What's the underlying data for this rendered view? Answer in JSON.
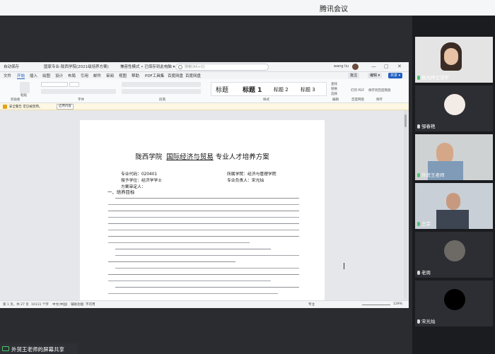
{
  "app": {
    "title": "腾讯会议"
  },
  "word": {
    "titlebar": {
      "autosave": "自动保存",
      "doc_name": "国家专业-陇西学院(2021级培养方案)",
      "compat": "兼容性模式 • 已保存到此电脑 ▾",
      "search_placeholder": "搜索(Alt+Q)",
      "user": "wang liu",
      "minimize": "—",
      "restore": "▢",
      "close": "✕"
    },
    "menus": [
      "文件",
      "开始",
      "插入",
      "绘图",
      "设计",
      "布局",
      "引用",
      "邮件",
      "审阅",
      "视图",
      "帮助",
      "PDF工具集",
      "百度网盘",
      "百度网盘"
    ],
    "active_menu": "开始",
    "menu_buttons": {
      "comment": "批注",
      "edit": "编辑 ▾",
      "share": "共享 ▾"
    },
    "ribbon": {
      "groups": [
        "剪贴板",
        "字体",
        "段落",
        "样式",
        "编辑",
        "百度网盘",
        "保存"
      ],
      "paste": "粘贴",
      "styles": [
        "标题",
        "标题 1",
        "标题 2",
        "标题 3"
      ],
      "find": "查找",
      "replace": "替换",
      "select": "选择",
      "open_pdf": "打印 PDF",
      "save_to_baidu": "保存到百度网盘"
    },
    "notice": {
      "label": "安全警告",
      "text": "宏已被禁用。",
      "button": "启用内容"
    },
    "document": {
      "title_prefix": "陇西学院",
      "title_major": "国际经济与贸易",
      "title_suffix": "专业人才培养方案",
      "code_label": "专业代码：020401",
      "college_label": "所属学院：经济与管理学院",
      "degree_label": "授予学位：经济学学士",
      "leader_label": "专业负责人：宋光灿",
      "reviewer_label": "方案审定人：",
      "section_1": "一、培养目标"
    },
    "status": {
      "page": "第 1 页，共 27 页",
      "words": "10111 个字",
      "lang": "中文(中国)",
      "accessibility": "辅助功能: 不可用",
      "focus": "专注",
      "zoom": "129%"
    }
  },
  "participants": [
    {
      "name": "杨光烨王浩宇",
      "type": "video",
      "mic": "on"
    },
    {
      "name": "邹春艳",
      "type": "avatar",
      "mic": "off"
    },
    {
      "name": "外贸王老师",
      "type": "video",
      "mic": "on"
    },
    {
      "name": "王宗",
      "type": "video",
      "mic": "on"
    },
    {
      "name": "老周",
      "type": "avatar",
      "mic": "off"
    },
    {
      "name": "宋光灿",
      "type": "avatar",
      "mic": "off"
    }
  ],
  "share_label": "外贸王老师的屏幕共享",
  "colors": {
    "word_blue": "#1f5fbf",
    "notice": "#fdf7e3",
    "mic_on": "#4cc36b"
  }
}
